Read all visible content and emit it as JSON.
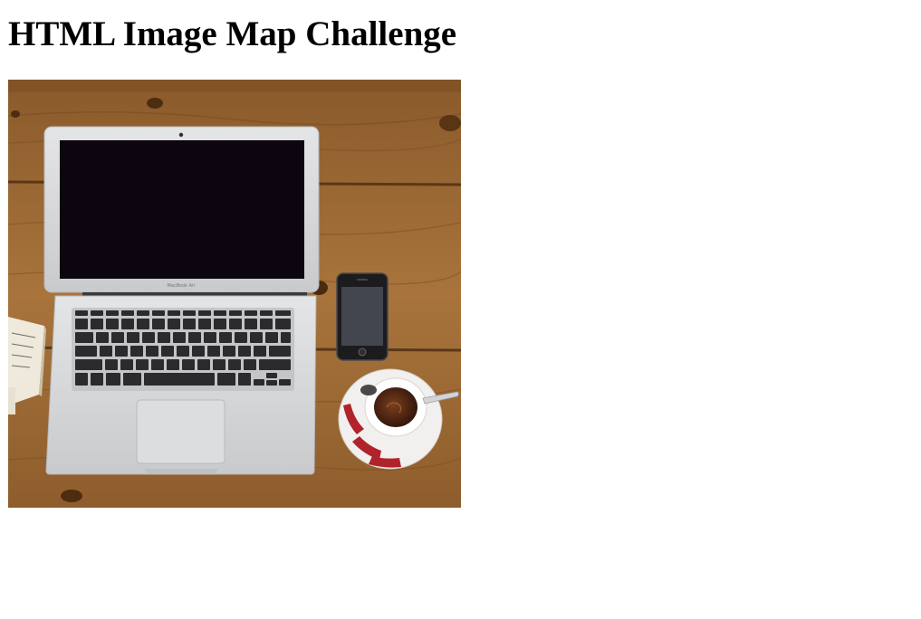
{
  "page": {
    "title": "HTML Image Map Challenge"
  },
  "image_map": {
    "hotspots": [
      {
        "label": "laptop",
        "icon": "laptop-icon"
      },
      {
        "label": "phone",
        "icon": "phone-icon"
      },
      {
        "label": "coffee",
        "icon": "coffee-cup-icon"
      },
      {
        "label": "notebook",
        "icon": "notebook-icon"
      }
    ],
    "colors": {
      "wood": "#9b6a35",
      "wood_dark": "#6e4421",
      "laptop_body": "#d7d8da",
      "screen": "#0c0610",
      "keys": "#2b2b2d",
      "coffee": "#4a2412",
      "saucer_stripe": "#b0232b"
    }
  }
}
